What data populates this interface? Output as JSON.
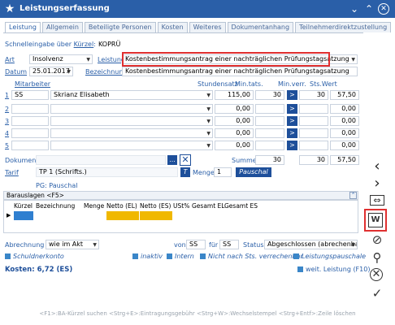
{
  "window": {
    "title": "Leistungserfassung"
  },
  "tabs": [
    "Leistung",
    "Allgemein",
    "Beteiligte Personen",
    "Kosten",
    "Weiteres",
    "Dokumentanhang",
    "Teilnehmerdirektzustellung"
  ],
  "quick": {
    "label_pre": "Schnelleingabe über ",
    "label_key": "Kürzel",
    "value": "KOPRÜ"
  },
  "art": {
    "label": "Art",
    "value": "Insolvenz"
  },
  "leistung": {
    "label": "Leistung",
    "value": "Kostenbestimmungsantrag einer nachträglichen Prüfungstagsatzung"
  },
  "datum": {
    "label": "Datum",
    "value": "25.01.2017"
  },
  "bezeichnung": {
    "label": "Bezeichnung",
    "value": "Kostenbestimmungsantrag einer nachträglichen Prüfungstagsatzung"
  },
  "table": {
    "headers": {
      "mitarbeiter": "Mitarbeiter",
      "stundensatz": "Stundensatz",
      "min_tats": "Min.tats.",
      "min_verr": "Min.verr.",
      "sts_wert": "Sts.Wert"
    },
    "rows": [
      {
        "n": "1",
        "code": "SS",
        "name": "Skrianz Elisabeth",
        "rate": "115,00",
        "mt": "30",
        "mv": "30",
        "wert": "57,50"
      },
      {
        "n": "2",
        "code": "",
        "name": "",
        "rate": "0,00",
        "mt": "",
        "mv": "",
        "wert": "0,00"
      },
      {
        "n": "3",
        "code": "",
        "name": "",
        "rate": "0,00",
        "mt": "",
        "mv": "",
        "wert": "0,00"
      },
      {
        "n": "4",
        "code": "",
        "name": "",
        "rate": "0,00",
        "mt": "",
        "mv": "",
        "wert": "0,00"
      },
      {
        "n": "5",
        "code": "",
        "name": "",
        "rate": "0,00",
        "mt": "",
        "mv": "",
        "wert": "0,00"
      }
    ],
    "go": ">"
  },
  "dokument": {
    "label": "Dokument",
    "dots": "...",
    "x": "✕"
  },
  "summe": {
    "label": "Summe:",
    "mt": "30",
    "mv": "30",
    "wert": "57,50"
  },
  "tarif": {
    "label": "Tarif",
    "value": "TP 1 (Schrifts.)",
    "t": "T",
    "menge_label": "Menge",
    "menge": "1",
    "pauschal": "Pauschal"
  },
  "pg": "PG: Pauschal",
  "barauslagen": {
    "title": "Barauslagen <F5>",
    "cols": [
      "Kürzel",
      "Bezeichnung",
      "Menge",
      "Netto (EL)",
      "Netto (ES)",
      "USt%",
      "Gesamt EL",
      "Gesamt ES"
    ]
  },
  "abrechnung": {
    "label": "Abrechnung",
    "value": "wie im Akt",
    "von_label": "von",
    "von": "SS",
    "fuer_label": "für",
    "fuer": "SS",
    "status_label": "Status",
    "status": "Abgeschlossen (abrechenbar)"
  },
  "checks": {
    "schuldnerkonto": "Schuldnerkonto",
    "inaktiv": "inaktiv",
    "intern": "Intern",
    "nicht_sts": "Nicht nach Sts. verrechenbar",
    "pauschale": "Leistungspauschale"
  },
  "kosten": "Kosten: 6,72 (ES)",
  "weit": "weit. Leistung (F10)",
  "statusbar": "<F1>:BA-Kürzel suchen  <Strg+E>:Eintragungsgebühr  <Strg+W>:Wechselstempel  <Strg+Entf>:Zeile löschen",
  "colors": {
    "titlebar": "#2a5fa8",
    "accent": "#1e4f9a",
    "highlight": "#e03030",
    "yellow": "#f0b800"
  }
}
